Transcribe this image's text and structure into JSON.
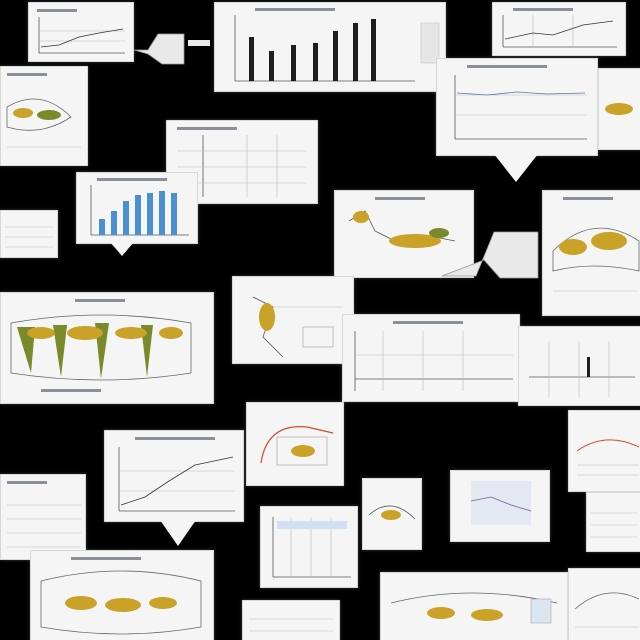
{
  "canvas": {
    "background": "#000000",
    "card_background": "#f4f5f4",
    "card_border": "#d6d8d6"
  },
  "palette": {
    "gold": "#c9a227",
    "olive": "#7a8a2a",
    "bar_dark": "#1e1e1e",
    "bar_blue": "#4a8fd0",
    "axis": "#555555",
    "gridline": "#b8bcc0",
    "accent_red": "#d04a30"
  },
  "cards": [
    {
      "id": "c1",
      "kind": "line-plot"
    },
    {
      "id": "c2",
      "kind": "dark-bar-chart"
    },
    {
      "id": "c3",
      "kind": "line-plot"
    },
    {
      "id": "c4",
      "kind": "line-plot"
    },
    {
      "id": "c5",
      "kind": "gold-diagram"
    },
    {
      "id": "c6",
      "kind": "table"
    },
    {
      "id": "c7",
      "kind": "blue-bar-chart"
    },
    {
      "id": "c8",
      "kind": "gold-diagram"
    },
    {
      "id": "c9",
      "kind": "gold-diagram"
    },
    {
      "id": "c10",
      "kind": "line-plot"
    },
    {
      "id": "c11",
      "kind": "gold-diagram"
    },
    {
      "id": "c12",
      "kind": "table"
    },
    {
      "id": "c13",
      "kind": "table"
    },
    {
      "id": "c14",
      "kind": "line-plot"
    },
    {
      "id": "c15",
      "kind": "line-plot"
    },
    {
      "id": "c16",
      "kind": "gold-diagram"
    },
    {
      "id": "c17",
      "kind": "table"
    },
    {
      "id": "c18",
      "kind": "gold-diagram"
    },
    {
      "id": "c19",
      "kind": "table"
    },
    {
      "id": "c20",
      "kind": "line-plot"
    },
    {
      "id": "c21",
      "kind": "gold-diagram"
    },
    {
      "id": "c22",
      "kind": "gold-diagram"
    },
    {
      "id": "c23",
      "kind": "gold-diagram"
    },
    {
      "id": "c24",
      "kind": "table"
    }
  ],
  "icons": [
    "connector-arrow-icon",
    "pointer-notch-icon"
  ]
}
